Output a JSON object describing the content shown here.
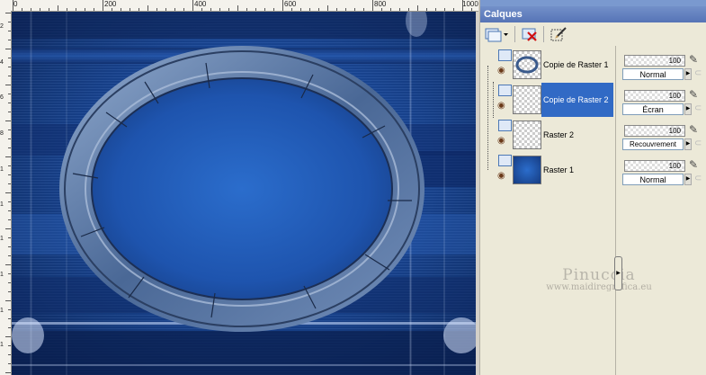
{
  "ruler": {
    "top_labels": [
      "0",
      "200",
      "400",
      "600",
      "800",
      "1000"
    ],
    "left_labels": [
      "2",
      "4",
      "6",
      "8",
      "1",
      "1",
      "1",
      "1",
      "1",
      "1"
    ]
  },
  "palette": {
    "title": "Calques",
    "toolbar": {
      "new_layer_icon": "new-layer-icon",
      "delete_layer_icon": "delete-layer-icon",
      "edit_icon": "edit-layer-icon"
    },
    "layers": [
      {
        "name": "Copie de Raster 1",
        "opacity": "100",
        "blend": "Normal",
        "selected": false
      },
      {
        "name": "Copie de Raster 2",
        "opacity": "100",
        "blend": "Écran",
        "selected": true
      },
      {
        "name": "Raster 2",
        "opacity": "100",
        "blend": "Recouvrement",
        "selected": false
      },
      {
        "name": "Raster 1",
        "opacity": "100",
        "blend": "Normal",
        "selected": false
      }
    ]
  },
  "watermark": {
    "name": "Pinuccia",
    "url": "www.maidiregrafica.eu"
  },
  "colors": {
    "canvas_blue": "#1c4ea4",
    "title_bar": "#5674b6",
    "selection": "#316ac5"
  }
}
